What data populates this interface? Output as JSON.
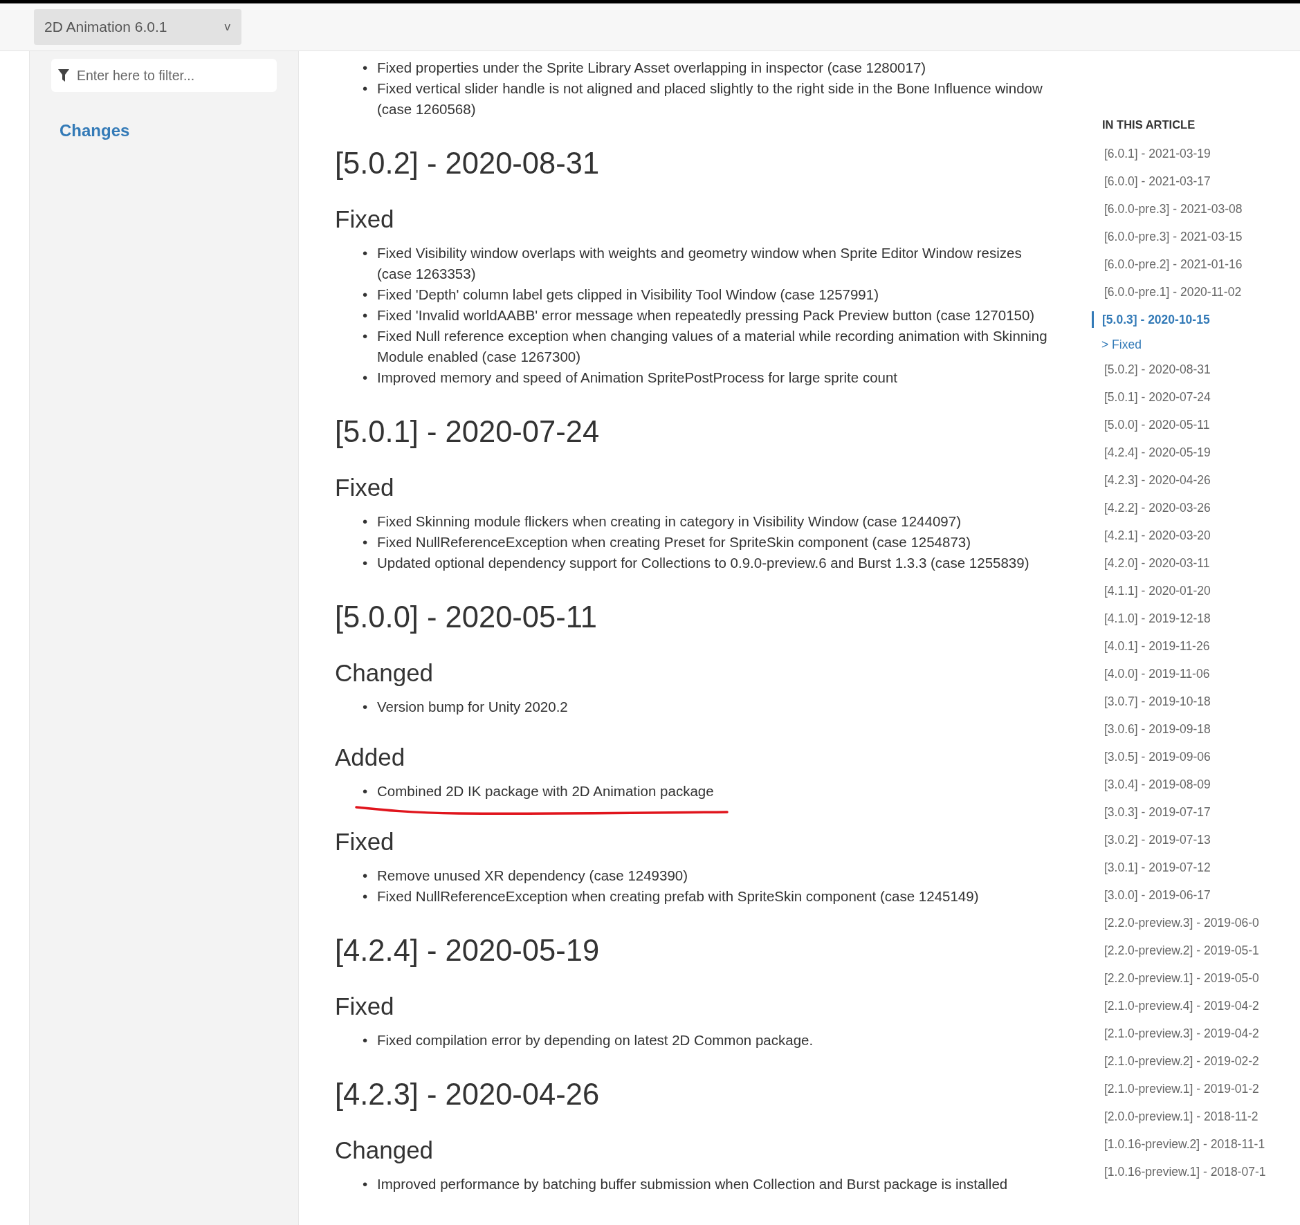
{
  "bullet": "•",
  "header": {
    "version_dropdown": {
      "label": "2D Animation 6.0.1",
      "caret": "v"
    }
  },
  "sidebar": {
    "filter": {
      "placeholder": "Enter here to filter..."
    },
    "items": [
      {
        "label": "Changes",
        "selected": true
      }
    ]
  },
  "article": {
    "top_items": [
      {
        "text": "Fixed properties under the Sprite Library Asset overlapping in inspector (case 1280017)",
        "underlined": false
      },
      {
        "text": "Fixed vertical slider handle is not aligned and placed slightly to the right side in the Bone Influence window (case 1260568)",
        "underlined": false
      }
    ],
    "sections": [
      {
        "heading": "[5.0.2] - 2020-08-31",
        "groups": [
          {
            "heading": "Fixed",
            "items": [
              {
                "text": "Fixed Visibility window overlaps with weights and geometry window when Sprite Editor Window resizes (case 1263353)",
                "underlined": false
              },
              {
                "text": "Fixed 'Depth' column label gets clipped in Visibility Tool Window (case 1257991)",
                "underlined": false
              },
              {
                "text": "Fixed 'Invalid worldAABB' error message when repeatedly pressing Pack Preview button (case 1270150)",
                "underlined": false
              },
              {
                "text": "Fixed Null reference exception when changing values of a material while recording animation with Skinning Module enabled (case 1267300)",
                "underlined": false
              },
              {
                "text": "Improved memory and speed of Animation SpritePostProcess for large sprite count",
                "underlined": false
              }
            ]
          }
        ]
      },
      {
        "heading": "[5.0.1] - 2020-07-24",
        "groups": [
          {
            "heading": "Fixed",
            "items": [
              {
                "text": "Fixed Skinning module flickers when creating in category in Visibility Window (case 1244097)",
                "underlined": false
              },
              {
                "text": "Fixed NullReferenceException when creating Preset for SpriteSkin component (case 1254873)",
                "underlined": false
              },
              {
                "text": "Updated optional dependency support for Collections to 0.9.0-preview.6 and Burst 1.3.3 (case 1255839)",
                "underlined": false
              }
            ]
          }
        ]
      },
      {
        "heading": "[5.0.0] - 2020-05-11",
        "groups": [
          {
            "heading": "Changed",
            "items": [
              {
                "text": "Version bump for Unity 2020.2",
                "underlined": false
              }
            ]
          },
          {
            "heading": "Added",
            "items": [
              {
                "text": "Combined 2D IK package with 2D Animation package",
                "underlined": true
              }
            ]
          },
          {
            "heading": "Fixed",
            "items": [
              {
                "text": "Remove unused XR dependency (case 1249390)",
                "underlined": false
              },
              {
                "text": "Fixed NullReferenceException when creating prefab with SpriteSkin component (case 1245149)",
                "underlined": false
              }
            ]
          }
        ]
      },
      {
        "heading": "[4.2.4] - 2020-05-19",
        "groups": [
          {
            "heading": "Fixed",
            "items": [
              {
                "text": "Fixed compilation error by depending on latest 2D Common package.",
                "underlined": false
              }
            ]
          }
        ]
      },
      {
        "heading": "[4.2.3] - 2020-04-26",
        "groups": [
          {
            "heading": "Changed",
            "items": [
              {
                "text": "Improved performance by batching buffer submission when Collection and Burst package is installed",
                "underlined": false
              }
            ]
          }
        ]
      }
    ]
  },
  "toc": {
    "title": "IN THIS ARTICLE",
    "items": [
      {
        "label": "[6.0.1] - 2021-03-19",
        "selected": false
      },
      {
        "label": "[6.0.0] - 2021-03-17",
        "selected": false
      },
      {
        "label": "[6.0.0-pre.3] - 2021-03-08",
        "selected": false
      },
      {
        "label": "[6.0.0-pre.3] - 2021-03-15",
        "selected": false
      },
      {
        "label": "[6.0.0-pre.2] - 2021-01-16",
        "selected": false
      },
      {
        "label": "[6.0.0-pre.1] - 2020-11-02",
        "selected": false
      },
      {
        "label": "[5.0.3] - 2020-10-15",
        "selected": true,
        "children": [
          {
            "marker": ">",
            "label": "Fixed"
          }
        ]
      },
      {
        "label": "[5.0.2] - 2020-08-31",
        "selected": false
      },
      {
        "label": "[5.0.1] - 2020-07-24",
        "selected": false
      },
      {
        "label": "[5.0.0] - 2020-05-11",
        "selected": false
      },
      {
        "label": "[4.2.4] - 2020-05-19",
        "selected": false
      },
      {
        "label": "[4.2.3] - 2020-04-26",
        "selected": false
      },
      {
        "label": "[4.2.2] - 2020-03-26",
        "selected": false
      },
      {
        "label": "[4.2.1] - 2020-03-20",
        "selected": false
      },
      {
        "label": "[4.2.0] - 2020-03-11",
        "selected": false
      },
      {
        "label": "[4.1.1] - 2020-01-20",
        "selected": false
      },
      {
        "label": "[4.1.0] - 2019-12-18",
        "selected": false
      },
      {
        "label": "[4.0.1] - 2019-11-26",
        "selected": false
      },
      {
        "label": "[4.0.0] - 2019-11-06",
        "selected": false
      },
      {
        "label": "[3.0.7] - 2019-10-18",
        "selected": false
      },
      {
        "label": "[3.0.6] - 2019-09-18",
        "selected": false
      },
      {
        "label": "[3.0.5] - 2019-09-06",
        "selected": false
      },
      {
        "label": "[3.0.4] - 2019-08-09",
        "selected": false
      },
      {
        "label": "[3.0.3] - 2019-07-17",
        "selected": false
      },
      {
        "label": "[3.0.2] - 2019-07-13",
        "selected": false
      },
      {
        "label": "[3.0.1] - 2019-07-12",
        "selected": false
      },
      {
        "label": "[3.0.0] - 2019-06-17",
        "selected": false
      },
      {
        "label": "[2.2.0-preview.3] - 2019-06-0",
        "selected": false
      },
      {
        "label": "[2.2.0-preview.2] - 2019-05-1",
        "selected": false
      },
      {
        "label": "[2.2.0-preview.1] - 2019-05-0",
        "selected": false
      },
      {
        "label": "[2.1.0-preview.4] - 2019-04-2",
        "selected": false
      },
      {
        "label": "[2.1.0-preview.3] - 2019-04-2",
        "selected": false
      },
      {
        "label": "[2.1.0-preview.2] - 2019-02-2",
        "selected": false
      },
      {
        "label": "[2.1.0-preview.1] - 2019-01-2",
        "selected": false
      },
      {
        "label": "[2.0.0-preview.1] - 2018-11-2",
        "selected": false
      },
      {
        "label": "[1.0.16-preview.2] - 2018-11-1",
        "selected": false
      },
      {
        "label": "[1.0.16-preview.1] - 2018-07-1",
        "selected": false
      }
    ]
  }
}
